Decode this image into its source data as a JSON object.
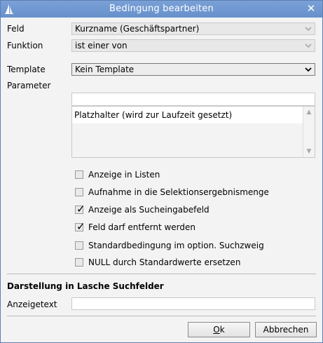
{
  "window": {
    "title": "Bedingung bearbeiten",
    "close_glyph": "✕"
  },
  "form": {
    "feld_label": "Feld",
    "feld_value": "Kurzname (Geschäftspartner)",
    "funktion_label": "Funktion",
    "funktion_value": "ist einer von",
    "template_label": "Template",
    "template_value": "Kein Template",
    "parameter_label": "Parameter",
    "parameter_input_value": "",
    "parameter_list": [
      "Platzhalter (wird zur Laufzeit gesetzt)"
    ]
  },
  "options": [
    {
      "label": "Anzeige in Listen",
      "checked": false
    },
    {
      "label": "Aufnahme in die Selektionsergebnismenge",
      "checked": false
    },
    {
      "label": "Anzeige als Sucheingabefeld",
      "checked": true
    },
    {
      "label": "Feld darf entfernt werden",
      "checked": true
    },
    {
      "label": "Standardbedingung im option. Suchzweig",
      "checked": false
    },
    {
      "label": "NULL durch Standardwerte ersetzen",
      "checked": false
    }
  ],
  "display_section": {
    "title": "Darstellung in Lasche Suchfelder",
    "anzeigetext_label": "Anzeigetext",
    "anzeigetext_value": ""
  },
  "buttons": {
    "ok_mnemonic": "O",
    "ok_rest": "k",
    "cancel_label": "Abbrechen"
  },
  "icons": {
    "app": "sail-icon",
    "close": "close-icon",
    "dropdown": "chevron-down-icon",
    "check": "checkmark-icon"
  },
  "colors": {
    "titlebar": "#6f96d0",
    "window_border": "#5a7fb5",
    "background": "#f3f3f3"
  }
}
